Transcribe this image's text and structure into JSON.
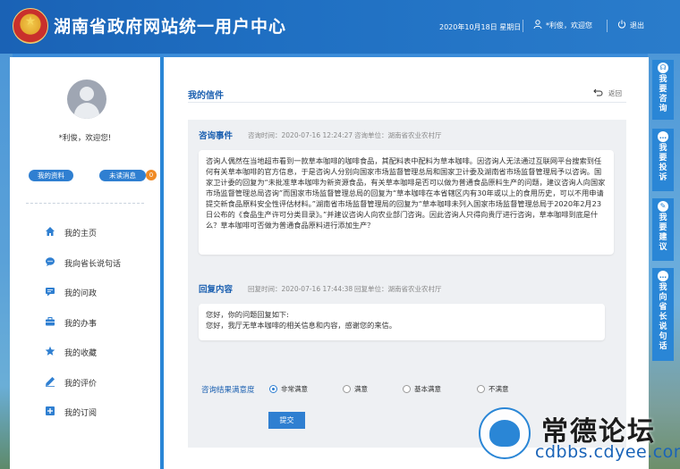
{
  "header": {
    "site_title": "湖南省政府网站统一用户中心",
    "date": "2020年10月18日 星期日",
    "user_greeting": "*利俊，欢迎您",
    "logout_label": "退出"
  },
  "sidebar": {
    "greeting": "*利俊，欢迎您!",
    "my_info_label": "我的资料",
    "unread_label": "未读消息",
    "unread_count": "0",
    "items": [
      {
        "label": "我的主页",
        "icon": "home-icon"
      },
      {
        "label": "我向省长说句话",
        "icon": "chat-icon"
      },
      {
        "label": "我的问政",
        "icon": "message-icon"
      },
      {
        "label": "我的办事",
        "icon": "briefcase-icon"
      },
      {
        "label": "我的收藏",
        "icon": "star-icon"
      },
      {
        "label": "我的评价",
        "icon": "pencil-icon"
      },
      {
        "label": "我的订阅",
        "icon": "plus-square-icon"
      }
    ]
  },
  "main": {
    "title": "我的信件",
    "back_label": "返回",
    "consult": {
      "label": "咨询事件",
      "time_label": "咨询时间：",
      "time": "2020-07-16 12:24:27",
      "unit_label": "咨询单位：",
      "unit": "湖南省农业农村厅",
      "content": "咨询人偶然在当地超市看到一款草本咖啡的咖啡食品，其配料表中配料为草本咖啡。因咨询人无法通过互联网平台搜索到任何有关草本咖啡的官方信息，于是咨询人分别向国家市场监督管理总局和国家卫计委及湖南省市场监督管理局予以咨询。国家卫计委的回复为“未批准草本咖啡为新资源食品，有关草本咖啡是否可以做为普通食品原料生产的问题，建议咨询人向国家市场监督管理总局咨询”而国家市场监督管理总局的回复为“草本咖啡在本省辖区内有30年或以上的食用历史，可以不用申请提交新食品原料安全性评估材料。”湖南省市场监督管理局的回复为“草本咖啡未列入国家市场监督管理总局于2020年2月23日公布的《食品生产许可分类目录》。”并建议咨询人向农业部门咨询。因此咨询人只得向贵厅进行咨询，草本咖啡到底是什么？草本咖啡可否做为普通食品原料进行添加生产？"
    },
    "reply": {
      "label": "回复内容",
      "time_label": "回复时间：",
      "time": "2020-07-16 17:44:38",
      "unit_label": "回复单位：",
      "unit": "湖南省农业农村厅",
      "line1": "您好，你的问题回复如下:",
      "line2": "您好，我厅无草本咖啡的相关信息和内容，感谢您的来信。"
    },
    "satisfaction": {
      "label": "咨询结果满意度",
      "options": [
        "非常满意",
        "满意",
        "基本满意",
        "不满意"
      ],
      "selected": "非常满意",
      "submit_label": "提交"
    }
  },
  "rail": [
    {
      "label": "我要咨询",
      "icon": "headset-icon"
    },
    {
      "label": "我要投诉",
      "icon": "chat-bubble-icon"
    },
    {
      "label": "我要建议",
      "icon": "pen-icon"
    },
    {
      "label": "我向省长说句话",
      "icon": "speech-icon"
    }
  ],
  "watermark": {
    "brand": "常德论坛",
    "url": "cdbbs.cdyee.com",
    "logo_text": "常德论坛"
  },
  "colors": {
    "primary": "#2f7fd1",
    "header": "#1f6fc2",
    "title_blue": "#1a5fb0",
    "badge_orange": "#f08a24"
  }
}
